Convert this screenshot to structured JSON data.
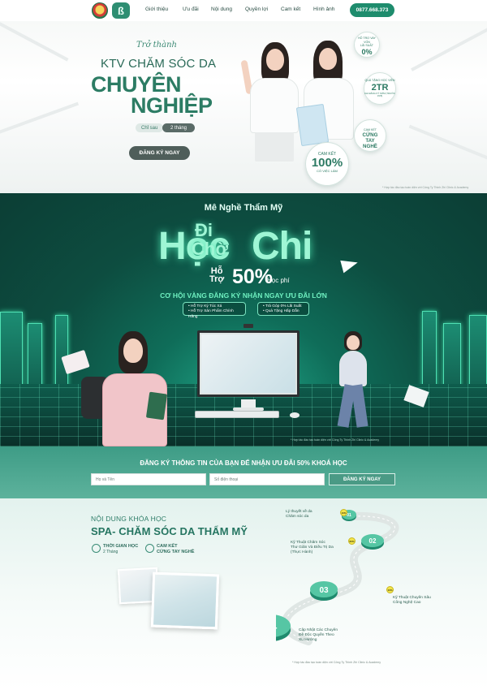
{
  "nav": {
    "items": [
      "Giới thiệu",
      "Ưu đãi",
      "Nội dung",
      "Quyền lợi",
      "Cam kết",
      "Hình ảnh"
    ],
    "phone": "0877.668.373"
  },
  "hero": {
    "pre_title": "Trở thành",
    "title_line1": "KTV CHĂM SÓC DA",
    "title_line2": "CHUYÊN",
    "title_line3": "NGHIỆP",
    "duration_prefix": "Chỉ sau",
    "duration_value": "2 tháng",
    "cta": "ĐĂNG KÝ NGAY",
    "disclaimer": "* Hợp tác đào tạo toàn diện với Công Ty Thinh Zhi Clinic & Academy",
    "badges": [
      {
        "small_top": "HỖ TRỢ VAY VỐN",
        "small_mid": "LÃI SUẤT",
        "big": "0%"
      },
      {
        "small_top": "QUÀ TẶNG HỌC VIÊN",
        "big": "2TR",
        "small_bottom": "KHI ĐĂNG KÝ SỚM (TRƯỚC 15/5)"
      },
      {
        "small_top": "CAM KẾT",
        "big": "CỨNG TAY NGHỀ"
      },
      {
        "small_top": "CAM KẾT",
        "big": "100%",
        "small_bottom": "CÓ VIỆC LÀM"
      }
    ]
  },
  "promo": {
    "heading": "Mê Nghề Thẩm Mỹ",
    "slogan_hoc": "Học",
    "slogan_di": "Đi",
    "slogan_cho": "Chờ",
    "slogan_chi": "Chi",
    "support_line1": "Hỗ",
    "support_line2": "Trợ",
    "support_value": "50%",
    "support_suffix": "Học phí",
    "subheading": "CƠ HỘI VÀNG ĐĂNG KÝ NHẬN NGAY ƯU ĐÃI LỚN",
    "perks_left": [
      "• Hỗ Trợ Ký Túc Xá",
      "• Hỗ Trợ Sản Phẩm Chính Hãng"
    ],
    "perks_right": [
      "• Trả Góp 0% Lãi Suất",
      "• Quà Tặng Hấp Dẫn"
    ],
    "disclaimer": "* Hợp tác đào tạo toàn diện với Công Ty Thinh Zhi Clinic & Academy"
  },
  "form": {
    "title": "ĐĂNG KÝ THÔNG TIN CỦA BẠN ĐỂ NHẬN ƯU ĐÃI 50% KHOÁ HỌC",
    "name_placeholder": "Họ và Tên",
    "phone_placeholder": "Số điện thoại",
    "submit": "ĐĂNG KÝ NGAY"
  },
  "course": {
    "section_label": "NỘI DUNG KHÓA HỌC",
    "title": "SPA- CHĂM SÓC DA THẨM MỸ",
    "info": [
      {
        "heading": "THỜI GIAN HỌC",
        "sub": "2 Tháng",
        "icon": "clock-icon"
      },
      {
        "heading": "CAM KẾT",
        "sub": "CỨNG TAY NGHỀ",
        "icon": "badge-icon"
      }
    ],
    "steps": [
      {
        "num": "01",
        "label": "Lý thuyết về da\nChăm sóc da",
        "pct": "10%"
      },
      {
        "num": "02",
        "label": "Kỹ Thuật Chăm Sóc\nThư Giãn Và Điều Trị Da\n(Thực Hành)",
        "pct": "60%"
      },
      {
        "num": "03",
        "label": "Kỹ Thuật Chuyên Sâu\nCông Nghệ Cao",
        "pct": "10%"
      },
      {
        "num": "04",
        "label": "Cập Nhật Các Chuyên\nĐề Độc Quyền Theo\nXu Hướng",
        "pct": ""
      }
    ],
    "disclaimer": "* Hợp tác đào tạo toàn diện với Công Ty Thinh Zhi Clinic & Academy"
  },
  "colors": {
    "brand_green": "#2c7c64",
    "dark_green": "#0c3e35",
    "neon_mint": "#9ff6d5",
    "cta_grey": "#4f5e5a"
  }
}
